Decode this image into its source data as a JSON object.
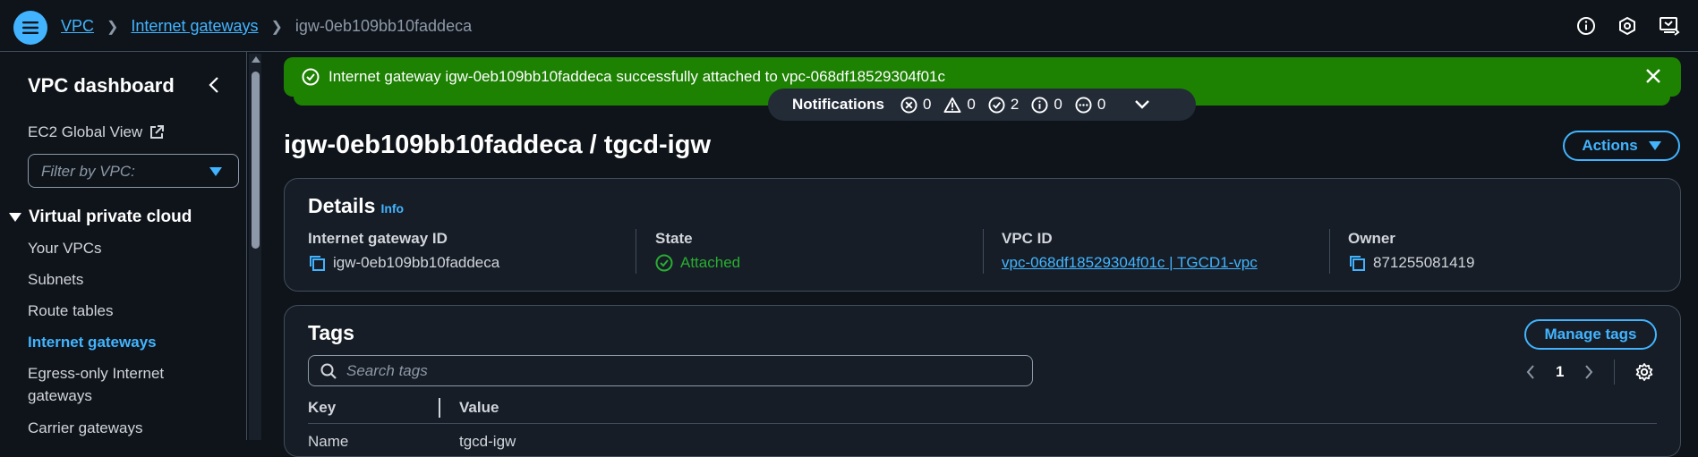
{
  "breadcrumb": {
    "items": [
      "VPC",
      "Internet gateways"
    ],
    "current": "igw-0eb109bb10faddeca"
  },
  "sidebar": {
    "title": "VPC dashboard",
    "ec2_global_view": "EC2 Global View",
    "filter_placeholder": "Filter by VPC:",
    "section": "Virtual private cloud",
    "items": [
      {
        "label": "Your VPCs"
      },
      {
        "label": "Subnets"
      },
      {
        "label": "Route tables"
      },
      {
        "label": "Internet gateways",
        "active": true
      },
      {
        "label": "Egress-only Internet gateways"
      },
      {
        "label": "Carrier gateways"
      }
    ]
  },
  "flash": {
    "message": "Internet gateway igw-0eb109bb10faddeca successfully attached to vpc-068df18529304f01c",
    "color": "#1d8102"
  },
  "notifications": {
    "label": "Notifications",
    "error": "0",
    "warning": "0",
    "success": "2",
    "info": "0",
    "in_progress": "0"
  },
  "page": {
    "title": "igw-0eb109bb10faddeca / tgcd-igw",
    "actions": "Actions"
  },
  "details": {
    "heading": "Details",
    "info": "Info",
    "gateway_id_label": "Internet gateway ID",
    "gateway_id": "igw-0eb109bb10faddeca",
    "state_label": "State",
    "state": "Attached",
    "vpc_label": "VPC ID",
    "vpc": "vpc-068df18529304f01c | TGCD1-vpc",
    "owner_label": "Owner",
    "owner": "871255081419"
  },
  "tags": {
    "heading": "Tags",
    "manage": "Manage tags",
    "search_placeholder": "Search tags",
    "page": "1",
    "columns": [
      "Key",
      "Value"
    ],
    "rows": [
      [
        "Name",
        "tgcd-igw"
      ]
    ]
  },
  "colors": {
    "accent": "#42b4ff",
    "success": "#29ad32",
    "background": "#0f141a"
  }
}
